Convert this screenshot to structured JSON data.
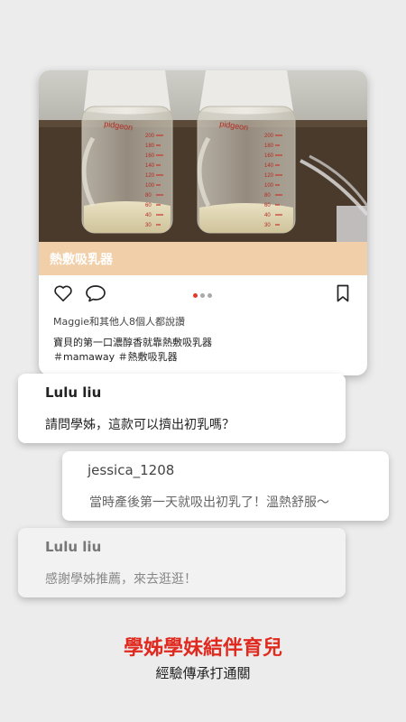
{
  "post": {
    "photo_alt": "two baby bottles with breast milk",
    "product_label": "熱敷吸乳器",
    "carousel": {
      "count": 3,
      "active_index": 0
    },
    "likes_text": "Maggie和其他人8個人都說讚",
    "caption_line1": "寶貝的第一口濃醇香就靠熱敷吸乳器",
    "caption_line2": "＃mamaway ＃熱敷吸乳器",
    "bottle_brand": "pidgeon",
    "bottle_scale": [
      "200",
      "180",
      "160",
      "140",
      "120",
      "100",
      "80",
      "60",
      "40",
      "30"
    ]
  },
  "comments": [
    {
      "user": "Lulu liu",
      "text": "請問學姊，這款可以擠出初乳嗎？"
    },
    {
      "user": "jessica_1208",
      "text": "當時產後第一天就吸出初乳了！溫熱舒服～"
    },
    {
      "user": "Lulu liu",
      "text": "感謝學姊推薦，來去逛逛！"
    }
  ],
  "footer": {
    "headline": "學姊學妹結伴育兒",
    "subline": "經驗傳承打通關"
  },
  "colors": {
    "accent": "#e02a1f",
    "band": "#f1cfa9",
    "dot_active": "#e03a2c",
    "dot_inactive": "#a9a9a9"
  },
  "icons": [
    "heart-icon",
    "comment-icon",
    "bookmark-icon"
  ]
}
